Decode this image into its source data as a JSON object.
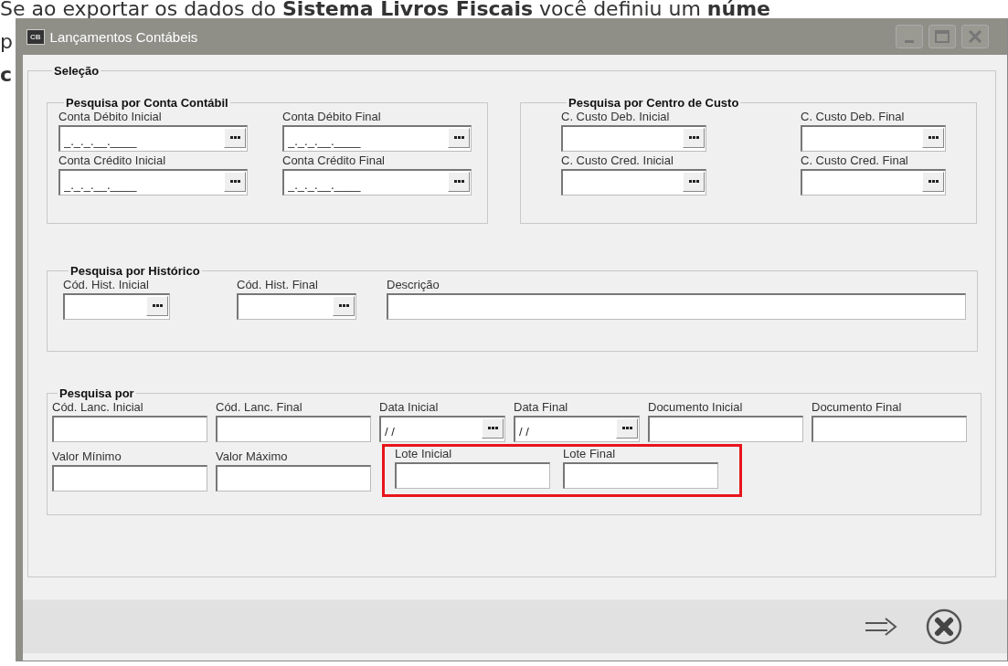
{
  "background_text": [
    {
      "text": "Se ao exportar os dados do **Sistema Livros Fiscais** você definiu um **núme**",
      "bold": false
    },
    {
      "text": "p",
      "bold": false
    },
    {
      "text": "c",
      "bold": true
    }
  ],
  "window": {
    "icon_text": "CB",
    "title": "Lançamentos Contábeis",
    "title_buttons": [
      {
        "kind": "minimize"
      },
      {
        "kind": "maximize"
      },
      {
        "kind": "close"
      }
    ],
    "selection_group": {
      "title": "Seleção",
      "account_group": {
        "title": "Pesquisa por Conta Contábil",
        "fields": [
          {
            "label": "Conta Débito Inicial",
            "kind": "lookup",
            "value": "_._._.__.____"
          },
          {
            "label": "Conta Débito Final",
            "kind": "lookup",
            "value": "_._._.__.____"
          },
          {
            "label": "Conta Crédito Inicial",
            "kind": "lookup",
            "value": "_._._.__.____"
          },
          {
            "label": "Conta Crédito Final",
            "kind": "lookup",
            "value": "_._._.__.____"
          }
        ]
      },
      "cost_center_group": {
        "title": "Pesquisa por Centro de Custo",
        "fields": [
          {
            "label": "C. Custo Deb. Inicial",
            "kind": "lookup"
          },
          {
            "label": "C. Custo Deb. Final",
            "kind": "lookup"
          },
          {
            "label": "C. Custo Cred. Inicial",
            "kind": "lookup"
          },
          {
            "label": "C. Custo Cred. Final",
            "kind": "lookup"
          }
        ]
      },
      "history_group": {
        "title": "Pesquisa por Histórico",
        "fields": [
          {
            "label": "Cód. Hist. Inicial",
            "kind": "lookup"
          },
          {
            "label": "Cód. Hist. Final",
            "kind": "lookup"
          },
          {
            "label": "Descrição",
            "kind": "plain"
          }
        ]
      },
      "search_group": {
        "title": "Pesquisa por",
        "rows": [
          {
            "fields": [
              {
                "label": "Cód. Lanc. Inicial",
                "kind": "plain",
                "highlighted": false
              },
              {
                "label": "Cód. Lanc. Final",
                "kind": "plain",
                "highlighted": false
              },
              {
                "label": "Data Inicial",
                "kind": "lookup",
                "value": "/ /",
                "highlighted": false
              },
              {
                "label": "Data Final",
                "kind": "lookup",
                "value": "/ /",
                "highlighted": false
              },
              {
                "label": "Documento Inicial",
                "kind": "plain",
                "highlighted": false
              },
              {
                "label": "Documento Final",
                "kind": "plain",
                "highlighted": false
              }
            ]
          },
          {
            "fields": [
              {
                "label": "Valor Mínimo",
                "kind": "plain",
                "highlighted": false
              },
              {
                "label": "Valor Máximo",
                "kind": "plain",
                "highlighted": false
              },
              {
                "label": "Lote Inicial",
                "kind": "plain",
                "highlighted": true
              },
              {
                "label": "Lote Final",
                "kind": "plain",
                "highlighted": true
              }
            ]
          }
        ]
      }
    },
    "footer_buttons": [
      {
        "kind": "confirm"
      },
      {
        "kind": "cancel"
      }
    ]
  }
}
